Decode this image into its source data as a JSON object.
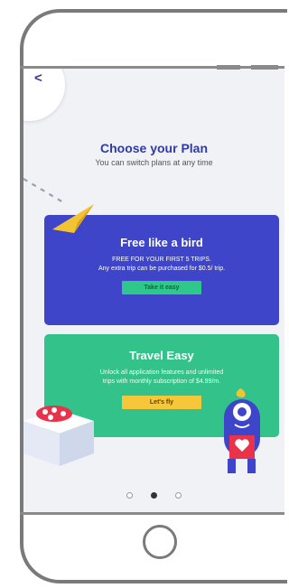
{
  "header": {
    "back_icon": "chevron-left-icon"
  },
  "plan": {
    "title": "Choose your Plan",
    "subtitle": "You can switch plans at any time"
  },
  "cards": [
    {
      "title": "Free like a bird",
      "line1": "FREE FOR YOUR FIRST 5 TRIPS.",
      "line2": "Any extra trip can be purchased for $0.5/ trip.",
      "button": "Take it easy",
      "color": "#3e45c9"
    },
    {
      "title": "Travel Easy",
      "line1": "Unlock all application features and unlimited",
      "line2": "trips with monthly subscription of $4.99/m.",
      "button": "Let's fly",
      "color": "#33c28a"
    }
  ],
  "pager": {
    "count": 3,
    "active_index": 1
  },
  "colors": {
    "accent": "#2f3aa8",
    "blue_card": "#3e45c9",
    "green_card": "#33c28a",
    "yellow_button": "#f7c73b"
  }
}
